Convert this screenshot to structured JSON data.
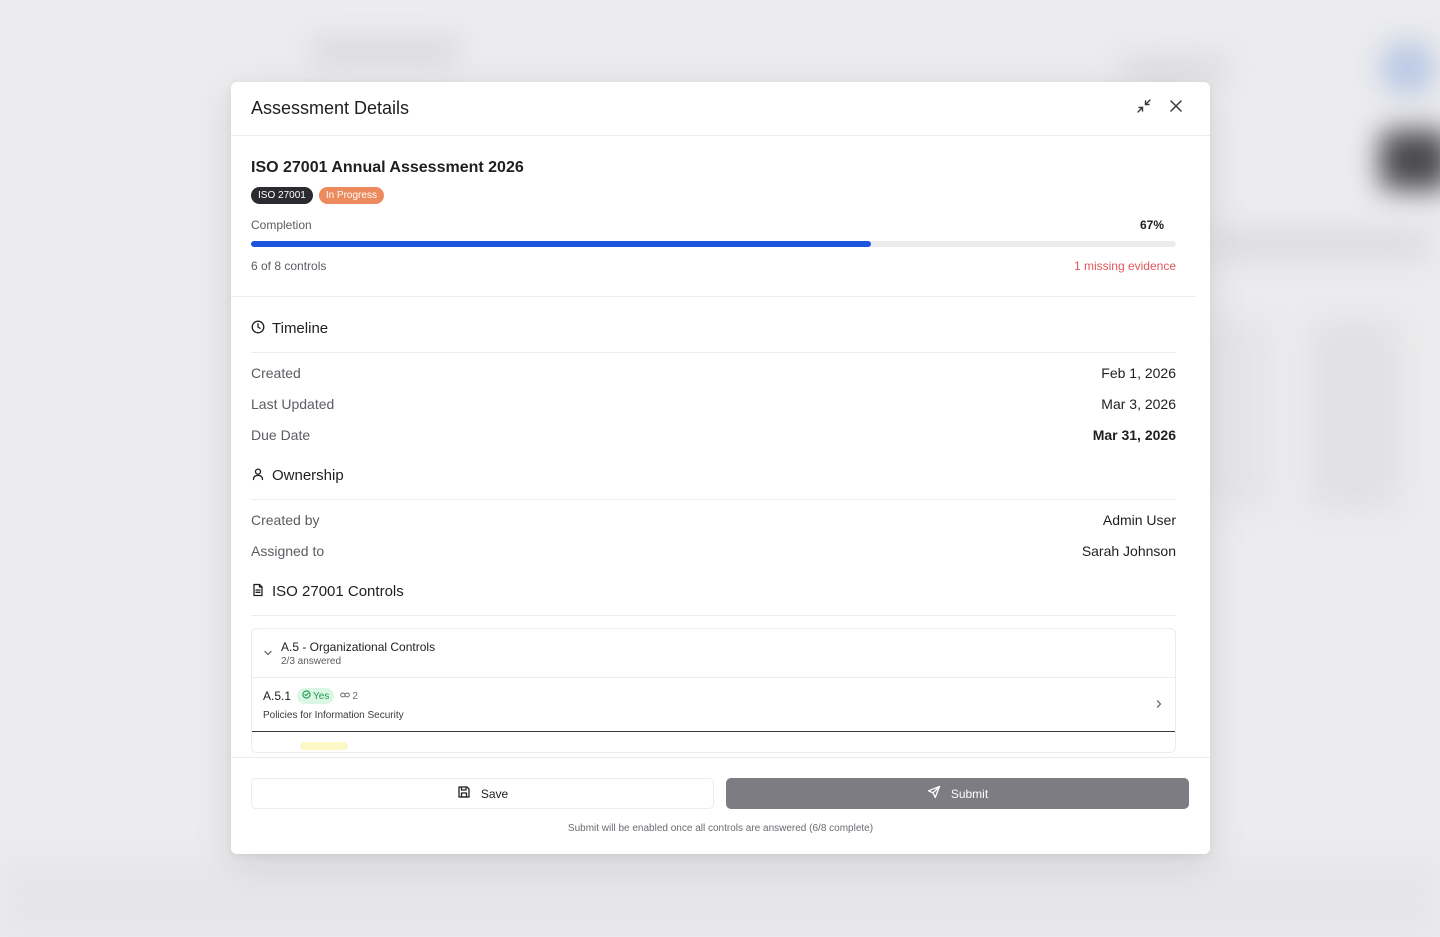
{
  "modal": {
    "title": "Assessment Details"
  },
  "assessment": {
    "name": "ISO 27001 Annual Assessment 2026",
    "framework_badge": "ISO 27001",
    "status_badge": "In Progress",
    "completion_label": "Completion",
    "completion_pct_label": "67%",
    "completion_fraction": 0.67,
    "controls_progress": "6 of 8 controls",
    "missing_evidence": "1 missing evidence"
  },
  "timeline": {
    "heading": "Timeline",
    "rows": [
      {
        "label": "Created",
        "value": "Feb 1, 2026"
      },
      {
        "label": "Last Updated",
        "value": "Mar 3, 2026"
      },
      {
        "label": "Due Date",
        "value": "Mar 31, 2026"
      }
    ]
  },
  "ownership": {
    "heading": "Ownership",
    "rows": [
      {
        "label": "Created by",
        "value": "Admin User"
      },
      {
        "label": "Assigned to",
        "value": "Sarah Johnson"
      }
    ]
  },
  "controls": {
    "heading": "ISO 27001 Controls",
    "group": {
      "title": "A.5 - Organizational Controls",
      "answered": "2/3 answered"
    },
    "items": [
      {
        "id": "A.5.1",
        "answer": "Yes",
        "links": "2",
        "description": "Policies for Information Security"
      }
    ]
  },
  "footer": {
    "save_label": "Save",
    "submit_label": "Submit",
    "hint": "Submit will be enabled once all controls are answered (6/8 complete)"
  },
  "colors": {
    "progress_fill": "#1d55e0",
    "status_badge": "#ec8a5e",
    "missing_evidence": "#e0575d",
    "yes_badge": "#1d9a4a",
    "submit_disabled": "#7c7c82"
  }
}
